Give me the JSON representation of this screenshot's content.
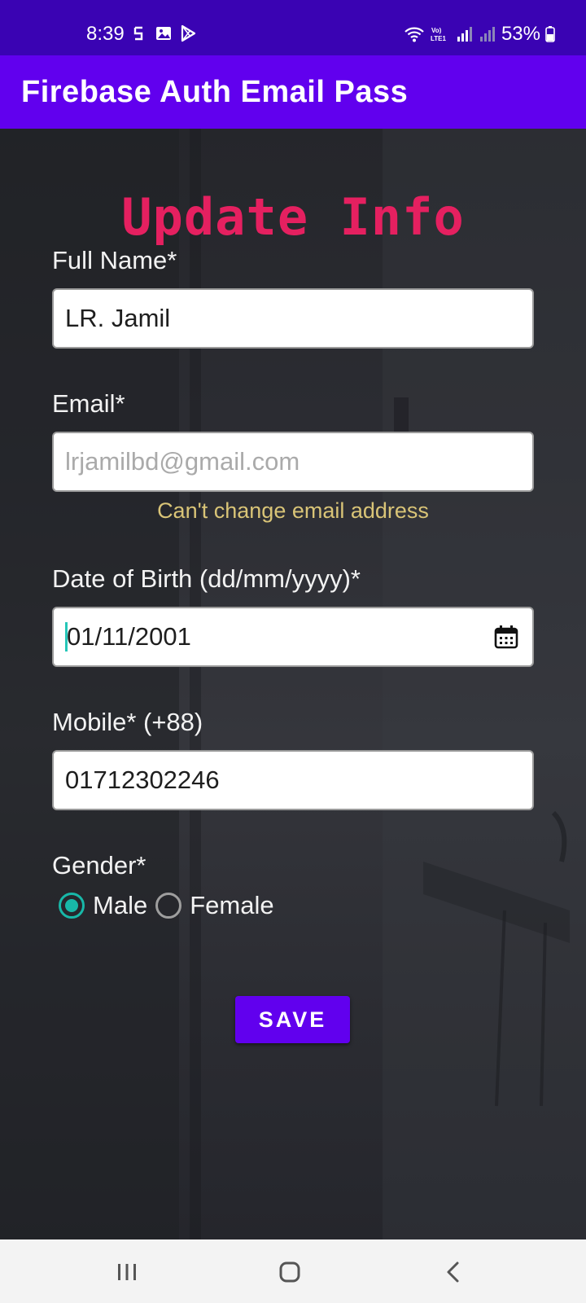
{
  "status_bar": {
    "time": "8:39",
    "battery": "53%",
    "icons": [
      "sim-s-icon",
      "gallery-icon",
      "play-store-icon",
      "wifi-icon",
      "volte-icon",
      "signal-icon",
      "signal-icon",
      "battery-icon"
    ],
    "background": "#3a03b3"
  },
  "app_bar": {
    "title": "Firebase Auth Email Pass",
    "background": "#6100ee"
  },
  "form": {
    "heading": "Update Info",
    "heading_color": "#e52060",
    "full_name": {
      "label": "Full Name*",
      "value": "LR. Jamil"
    },
    "email": {
      "label": "Email*",
      "value": "lrjamilbd@gmail.com",
      "hint": "Can't change email address"
    },
    "dob": {
      "label": "Date of Birth (dd/mm/yyyy)*",
      "value": "01/11/2001"
    },
    "mobile": {
      "label": "Mobile* (+88)",
      "value": "01712302246"
    },
    "gender": {
      "label": "Gender*",
      "options": [
        "Male",
        "Female"
      ],
      "selected": "Male"
    },
    "save_label": "SAVE",
    "accent": "#18b8a8"
  },
  "nav_bar": {
    "buttons": [
      "recents-icon",
      "home-icon",
      "back-icon"
    ]
  }
}
